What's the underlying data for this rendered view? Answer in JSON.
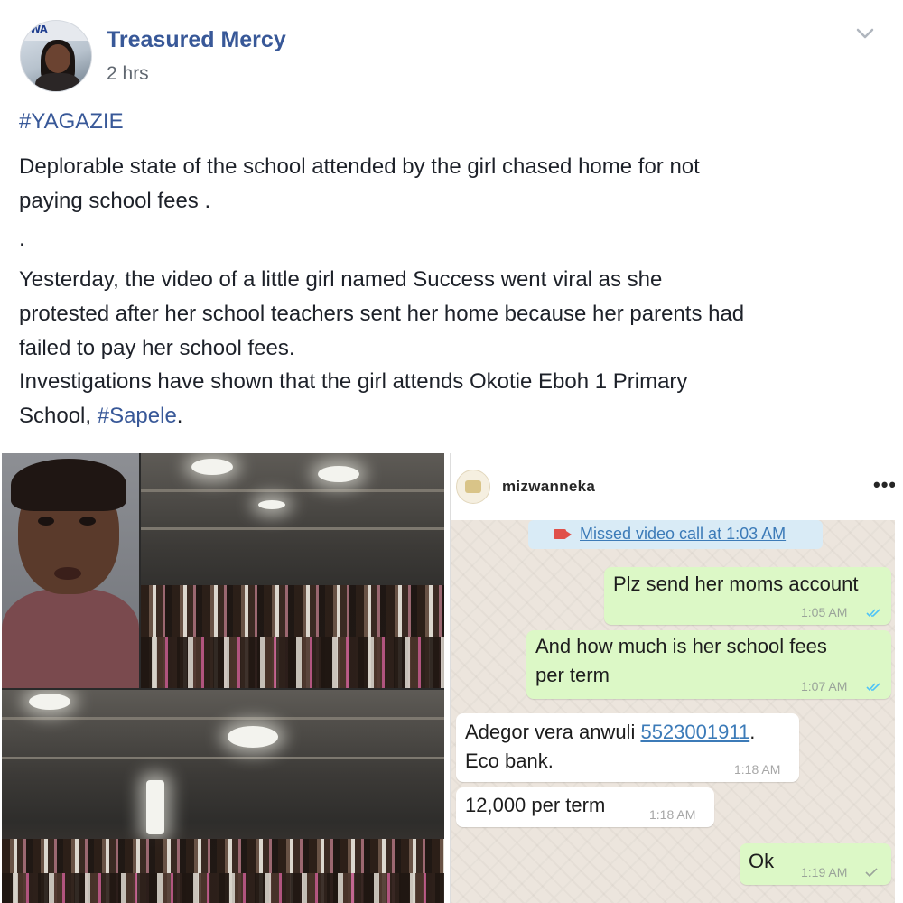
{
  "post": {
    "author": "Treasured Mercy",
    "time": "2 hrs",
    "avatar_sign": "WA",
    "hashtag_line": "#YAGAZIE",
    "lines": {
      "l1": "Deplorable state of the school attended by the girl chased home for not",
      "l2": "paying school fees .",
      "dot": ".",
      "l3": "Yesterday, the video of a little girl named Success went viral as she",
      "l4": "protested after her school teachers sent her home because her parents had",
      "l5": "failed to pay her school fees.",
      "l6": "Investigations have shown that the girl attends Okotie Eboh 1 Primary",
      "l7_prefix": "School, ",
      "l7_tag": "#Sapele",
      "l7_suffix": "."
    },
    "colors": {
      "link": "#385898",
      "text": "#1d2129",
      "muted": "#606770"
    }
  },
  "chat": {
    "contact": "mizwanneka",
    "more": "•••",
    "missed_call": "Missed video call at 1:03 AM",
    "messages": [
      {
        "dir": "out",
        "text": "Plz send her moms account",
        "time": "1:05 AM",
        "status": "read"
      },
      {
        "dir": "out",
        "text": "And how much is her school fees",
        "text2": "per term",
        "time": "1:07 AM",
        "status": "read"
      },
      {
        "dir": "in",
        "text": "Adegor vera anwuli ",
        "account": "5523001911",
        "text_after": ".",
        "text2": "Eco bank.",
        "time": "1:18 AM"
      },
      {
        "dir": "in",
        "text": "12,000 per term",
        "time": "1:18 AM"
      },
      {
        "dir": "out",
        "text": "Ok",
        "time": "1:19 AM",
        "status": "delivered"
      }
    ],
    "colors": {
      "outgoing": "#dcf8c6",
      "incoming": "#ffffff",
      "background": "#ece5dd",
      "read_ticks": "#4fc3f7"
    }
  },
  "icons": [
    "chevron-down-icon",
    "video-call-icon",
    "read-ticks-icon",
    "sent-tick-icon",
    "more-options-icon"
  ]
}
